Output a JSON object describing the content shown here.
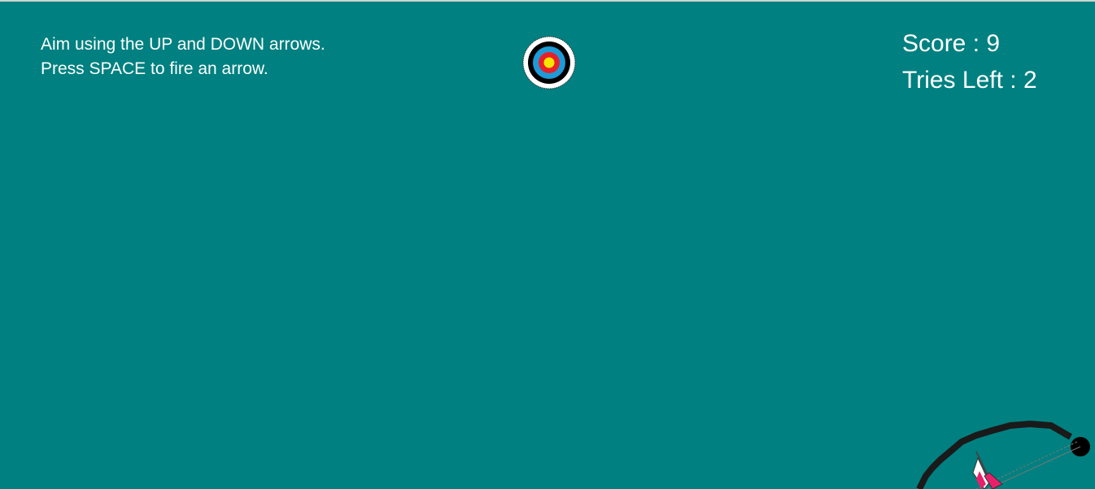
{
  "instructions": {
    "line1": "Aim using the UP and DOWN arrows.",
    "line2": "Press SPACE to fire an arrow."
  },
  "hud": {
    "score_label": "Score",
    "score_value": 9,
    "tries_label": "Tries Left",
    "tries_value": 2
  },
  "colors": {
    "background": "#008080",
    "text": "#ffffff",
    "target_rings": [
      "#ffffff",
      "#000000",
      "#1e9bd7",
      "#e8202a",
      "#f5e600"
    ],
    "bow": "#1a1a1a",
    "arrow_fletching": "#e8206a"
  },
  "icons": {
    "target": "archery-target-icon",
    "bow": "bow-icon",
    "arrow": "arrow-icon"
  }
}
